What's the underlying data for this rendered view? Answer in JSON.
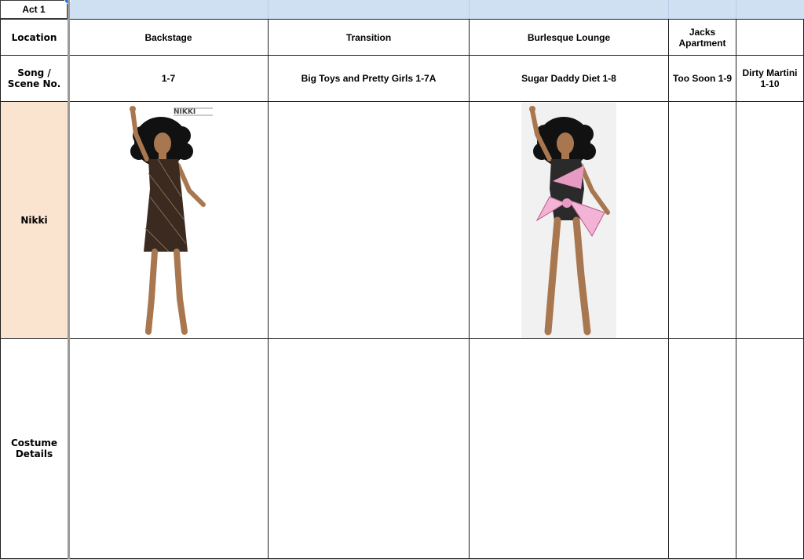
{
  "sheet": {
    "act_label": "Act 1",
    "row_headers": {
      "location": "Location",
      "song_scene": "Song / Scene No.",
      "character": "Nikki",
      "costume_details": "Costume Details"
    },
    "columns": [
      {
        "location": "Backstage",
        "scene": "1-7"
      },
      {
        "location": "Transition",
        "scene": "Big Toys and Pretty Girls 1-7A"
      },
      {
        "location": "Burlesque Lounge",
        "scene": "Sugar Daddy Diet 1-8"
      },
      {
        "location": "Jacks Apartment",
        "scene": "Too Soon 1-9"
      },
      {
        "location": "",
        "scene": "Dirty Martini 1-10"
      }
    ],
    "images": {
      "sketch_1": {
        "caption": "costume sketch - black sheer dress",
        "sketch_text": "NIKKI"
      },
      "sketch_2": {
        "caption": "costume sketch - black bodysuit with pink bow"
      }
    }
  }
}
